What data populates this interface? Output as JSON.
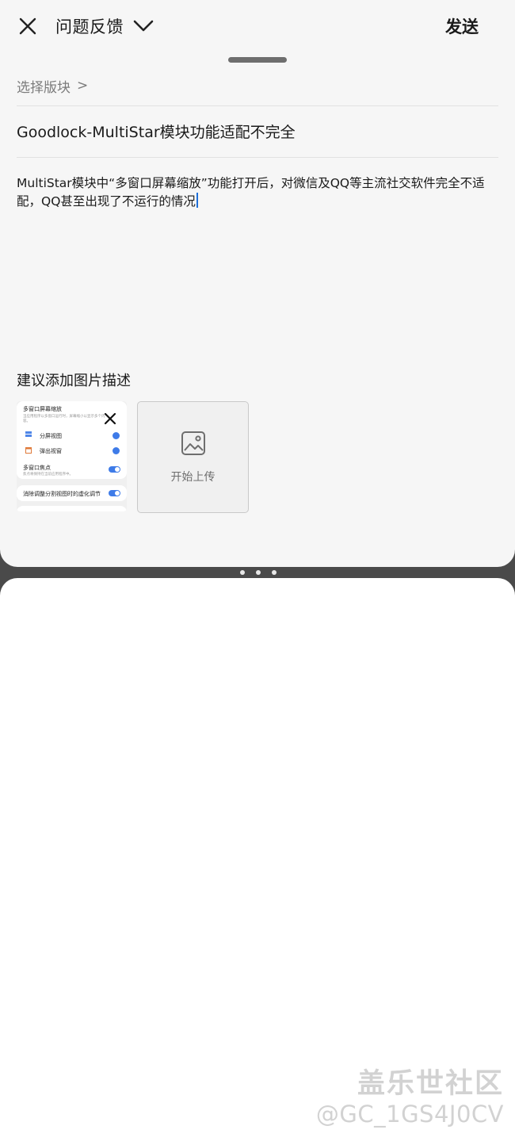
{
  "header": {
    "title": "问题反馈",
    "send_label": "发送",
    "close_icon": "close-icon",
    "dropdown_icon": "chevron-down-icon"
  },
  "form": {
    "section_select_label": "选择版块",
    "section_select_arrow": ">",
    "subject": "Goodlock-MultiStar模块功能适配不完全",
    "body": "MultiStar模块中“多窗口屏幕缩放”功能打开后，对微信及QQ等主流社交软件完全不适配，QQ甚至出现了不运行的情况",
    "photo_hint": "建议添加图片描述",
    "upload_label": "开始上传",
    "upload_icon": "image-icon"
  },
  "attachment": {
    "title": "多窗口屏幕缩放",
    "subtitle": "当应用程序以多窗口运行时，屏幕缩小以显示多个内容。",
    "item1": "分屏视图",
    "item2": "弹出视窗",
    "focus_title": "多窗口焦点",
    "focus_sub": "焦点将保持在当前应用程序中。",
    "blur_label": "消除调整分割视图时的虚化调节",
    "remove_icon": "close-icon"
  },
  "watermark": {
    "name": "盖乐世社区",
    "user": "@GC_1GS4J0CV"
  },
  "colors": {
    "panel_bg": "#f6f6f6",
    "text": "#1a1a1a",
    "caret": "#1e6fd9",
    "accent": "#3e7be8"
  }
}
